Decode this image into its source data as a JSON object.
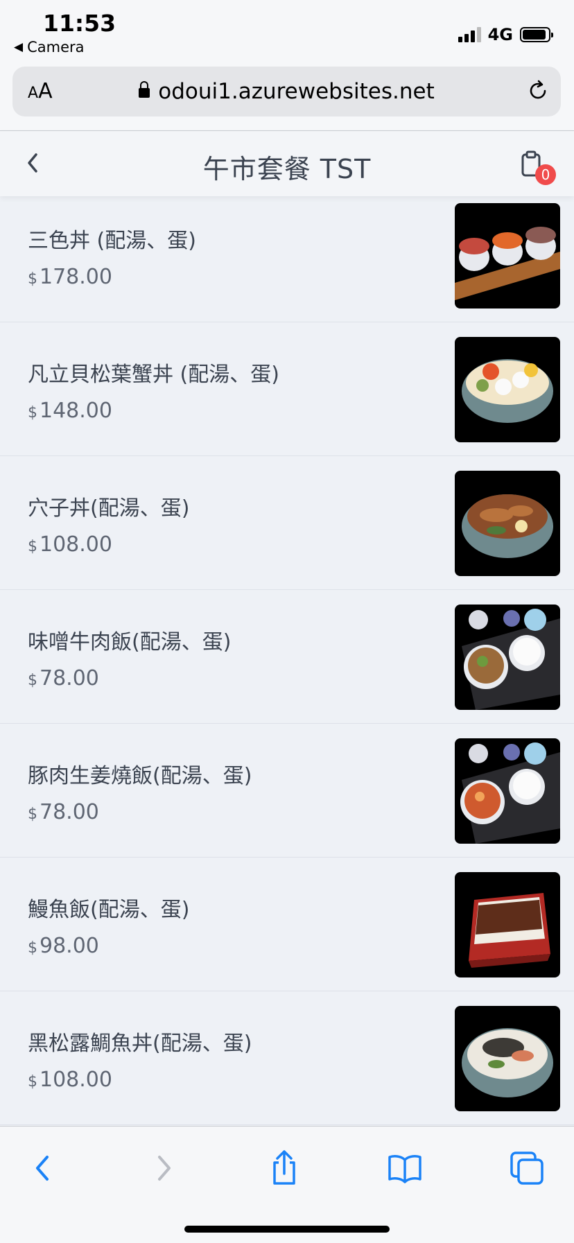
{
  "status_bar": {
    "time": "11:53",
    "back_app": "Camera",
    "network": "4G",
    "icons": [
      "signal-icon",
      "battery-icon"
    ]
  },
  "browser": {
    "text_size_label": "AA",
    "url": "odoui1.azurewebsites.net",
    "icons": [
      "lock-icon",
      "reload-icon"
    ]
  },
  "header": {
    "title": "午市套餐 TST",
    "cart_count": "0",
    "icons": [
      "back-icon",
      "cart-icon"
    ]
  },
  "menu": {
    "currency": "$",
    "items": [
      {
        "name": "三色丼 (配湯、蛋)",
        "price": "178.00"
      },
      {
        "name": "凡立貝松葉蟹丼 (配湯、蛋)",
        "price": "148.00"
      },
      {
        "name": "穴子丼(配湯、蛋)",
        "price": "108.00"
      },
      {
        "name": "味噌牛肉飯(配湯、蛋)",
        "price": "78.00"
      },
      {
        "name": "豚肉生姜燒飯(配湯、蛋)",
        "price": "78.00"
      },
      {
        "name": "鰻魚飯(配湯、蛋)",
        "price": "98.00"
      },
      {
        "name": "黑松露鯛魚丼(配湯、蛋)",
        "price": "108.00"
      }
    ]
  },
  "toolbar": {
    "icons": [
      "back-arrow-icon",
      "forward-arrow-icon",
      "share-icon",
      "bookmarks-icon",
      "tabs-icon"
    ]
  },
  "colors": {
    "accent_blue": "#1a82f7",
    "badge_red": "#f04b4b",
    "background": "#eef1f6"
  }
}
